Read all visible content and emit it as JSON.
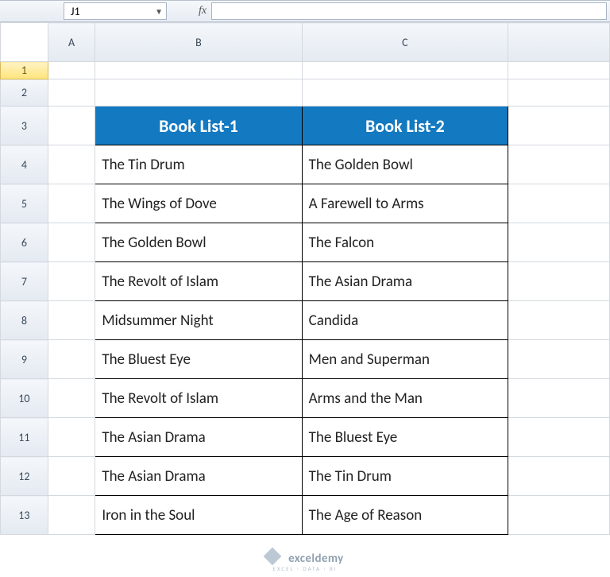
{
  "formula_bar": {
    "name_box": "J1",
    "fx_label": "fx",
    "formula": ""
  },
  "columns": {
    "A": "A",
    "B": "B",
    "C": "C"
  },
  "rows": [
    "1",
    "2",
    "3",
    "4",
    "5",
    "6",
    "7",
    "8",
    "9",
    "10",
    "11",
    "12",
    "13"
  ],
  "table": {
    "headers": {
      "b": "Book List-1",
      "c": "Book List-2"
    },
    "data": [
      {
        "b": "The Tin Drum",
        "c": "The Golden Bowl"
      },
      {
        "b": "The Wings of Dove",
        "c": "A Farewell to Arms"
      },
      {
        "b": "The Golden Bowl",
        "c": "The Falcon"
      },
      {
        "b": "The Revolt of Islam",
        "c": "The Asian Drama"
      },
      {
        "b": "Midsummer Night",
        "c": "Candida"
      },
      {
        "b": "The Bluest Eye",
        "c": "Men and Superman"
      },
      {
        "b": "The Revolt of Islam",
        "c": "Arms and the Man"
      },
      {
        "b": "The Asian Drama",
        "c": "The Bluest Eye"
      },
      {
        "b": "The Asian Drama",
        "c": "The Tin Drum"
      },
      {
        "b": "Iron in the Soul",
        "c": "The Age of Reason"
      }
    ]
  },
  "footer": {
    "brand": "exceldemy",
    "tagline": "EXCEL · DATA · BI"
  }
}
